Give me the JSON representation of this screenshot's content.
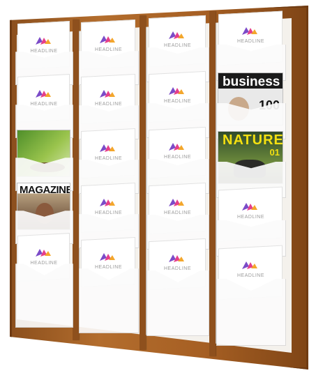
{
  "brochure_text": "HEADLINE",
  "magazines": {
    "business": {
      "title": "business",
      "number": "100"
    },
    "nature": {
      "title": "NATURE",
      "issue": "01"
    },
    "magazine": {
      "title": "MAGAZINE"
    }
  },
  "colors": {
    "wood": "#a65f23",
    "logo_pink": "#e53f8a",
    "logo_purple": "#7b4bc8",
    "logo_orange": "#f3a62c",
    "nature_yellow": "#f4e011"
  }
}
